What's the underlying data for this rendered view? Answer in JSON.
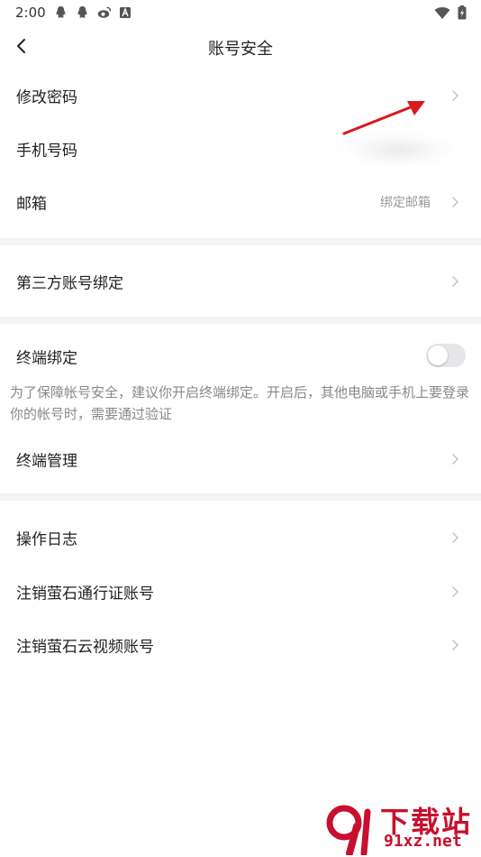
{
  "status_bar": {
    "time": "2:00",
    "left_icons": [
      "qq-icon",
      "qq-icon",
      "weibo-icon",
      "notification-a-icon"
    ],
    "right_icons": [
      "wifi-icon",
      "battery-icon"
    ]
  },
  "nav": {
    "title": "账号安全",
    "back_icon": "chevron-left-icon"
  },
  "rows": {
    "change_password": {
      "label": "修改密码"
    },
    "phone": {
      "label": "手机号码"
    },
    "email": {
      "label": "邮箱",
      "value": "绑定邮箱"
    },
    "third_party": {
      "label": "第三方账号绑定"
    },
    "terminal_binding": {
      "label": "终端绑定",
      "enabled": false,
      "description": "为了保障帐号安全，建议你开启终端绑定。开启后，其他电脑或手机上要登录你的帐号时，需要通过验证"
    },
    "terminal_manage": {
      "label": "终端管理"
    },
    "operation_log": {
      "label": "操作日志"
    },
    "cancel_pass_account": {
      "label": "注销萤石通行证账号"
    },
    "cancel_cloud_account": {
      "label": "注销萤石云视频账号"
    }
  },
  "watermark": {
    "title": "下载站",
    "url": "91xz.net"
  },
  "colors": {
    "divider": "#f4f4f6",
    "annotation_arrow": "#d91a1a",
    "watermark": "#c8102e"
  }
}
